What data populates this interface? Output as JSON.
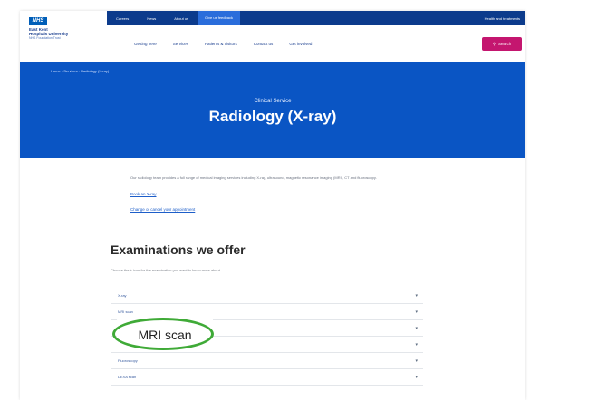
{
  "top_nav": {
    "items": [
      "Careers",
      "News",
      "About us",
      "Give us feedback"
    ],
    "active_index": 3,
    "right_label": "Health and treatments"
  },
  "logo": {
    "mark": "NHS",
    "lines": [
      "East Kent",
      "Hospitals University"
    ],
    "sub": "NHS Foundation Trust"
  },
  "main_nav": {
    "items": [
      "Getting here",
      "Services",
      "Patients & visitors",
      "Contact us",
      "Get involved"
    ],
    "search_label": "Search"
  },
  "hero": {
    "breadcrumb": "Home › Services › Radiology (X-ray)",
    "kicker": "Clinical Service",
    "title": "Radiology (X-ray)"
  },
  "intro": {
    "text": "Our radiology team provides a full range of medical imaging services including X-ray, ultrasound, magnetic resonance imaging (MRI), CT and fluoroscopy.",
    "links": [
      "Book an X-ray",
      "Change or cancel your appointment"
    ]
  },
  "section": {
    "title": "Examinations we offer",
    "hint": "Choose the + icon for the examination you want to know more about."
  },
  "accordion": {
    "items": [
      "X-ray",
      "MRI scan",
      "CT scan",
      "Ultrasound",
      "Fluoroscopy",
      "DEXA scan"
    ]
  },
  "callout": {
    "text": "MRI scan",
    "color": "#3faa37"
  },
  "colors": {
    "nav": "#0c3b8c",
    "hero": "#0a55c4",
    "search": "#c4166f"
  }
}
